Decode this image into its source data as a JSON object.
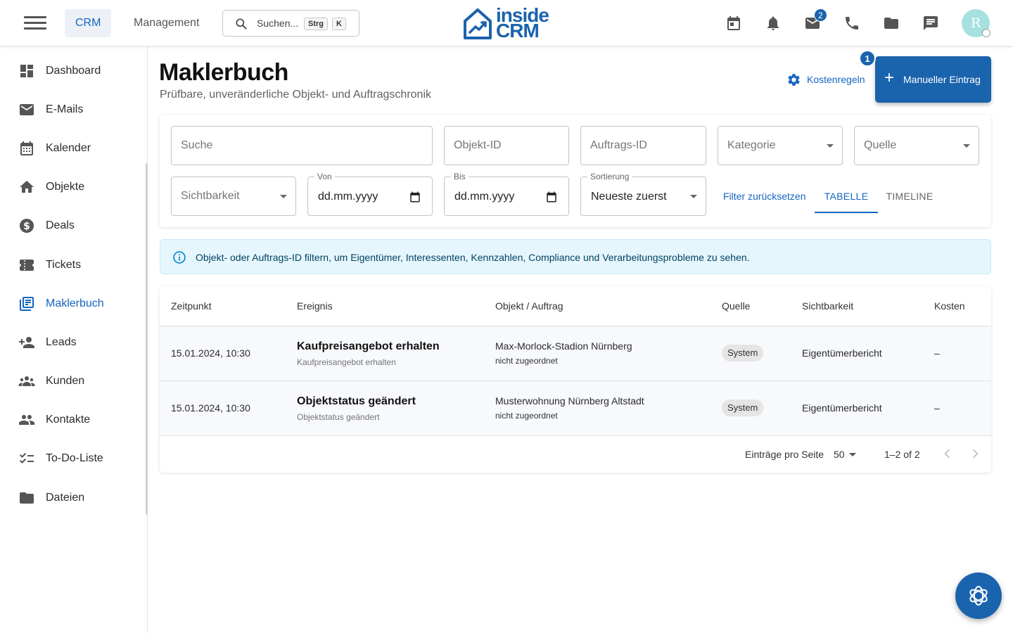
{
  "topbar": {
    "nav_tabs": [
      {
        "label": "CRM",
        "active": true
      },
      {
        "label": "Management",
        "active": false
      }
    ],
    "search": {
      "placeholder": "Suchen...",
      "shortcut_1": "Strg",
      "shortcut_2": "K"
    },
    "logo": {
      "line1": "inside",
      "line2": "CRM"
    },
    "icons": [
      "calendar-icon",
      "bell-icon",
      "mail-icon",
      "phone-icon",
      "folder-icon",
      "chat-icon"
    ],
    "mail_badge": "2",
    "avatar_initial": "R",
    "accent_color": "#1a63ad"
  },
  "sidebar": {
    "items": [
      {
        "label": "Dashboard",
        "icon": "dashboard-icon"
      },
      {
        "label": "E-Mails",
        "icon": "mail-icon"
      },
      {
        "label": "Kalender",
        "icon": "calendar-icon"
      },
      {
        "label": "Objekte",
        "icon": "home-icon"
      },
      {
        "label": "Deals",
        "icon": "dollar-icon"
      },
      {
        "label": "Tickets",
        "icon": "ticket-icon"
      },
      {
        "label": "Maklerbuch",
        "icon": "library-icon",
        "active": true
      },
      {
        "label": "Leads",
        "icon": "person-add-icon"
      },
      {
        "label": "Kunden",
        "icon": "groups-icon"
      },
      {
        "label": "Kontakte",
        "icon": "people-icon"
      },
      {
        "label": "To-Do-Liste",
        "icon": "checklist-icon"
      },
      {
        "label": "Dateien",
        "icon": "folder-icon"
      }
    ]
  },
  "header": {
    "title": "Maklerbuch",
    "subtitle": "Prüfbare, unveränderliche Objekt- und Auftragschronik",
    "cost_rules_label": "Kostenregeln",
    "manual_entry_label": "Manueller Eintrag",
    "manual_entry_badge": "1"
  },
  "filters": {
    "search_placeholder": "Suche",
    "object_id_placeholder": "Objekt-ID",
    "order_id_placeholder": "Auftrags-ID",
    "category_placeholder": "Kategorie",
    "source_placeholder": "Quelle",
    "visibility_placeholder": "Sichtbarkeit",
    "from_label": "Von",
    "from_value": "dd.mm.yyyy",
    "to_label": "Bis",
    "to_value": "dd.mm.yyyy",
    "sort_label": "Sortierung",
    "sort_value": "Neueste zuerst",
    "reset_label": "Filter zurücksetzen",
    "view_tabs": [
      {
        "label": "TABELLE",
        "active": true
      },
      {
        "label": "TIMELINE",
        "active": false
      }
    ]
  },
  "info": {
    "text": "Objekt- oder Auftrags-ID filtern, um Eigentümer, Interessenten, Kennzahlen, Compliance und Verarbeitungsprobleme zu sehen."
  },
  "table": {
    "columns": [
      "Zeitpunkt",
      "Ereignis",
      "Objekt / Auftrag",
      "Quelle",
      "Sichtbarkeit",
      "Kosten"
    ],
    "rows": [
      {
        "time": "15.01.2024, 10:30",
        "event_title": "Kaufpreisangebot erhalten",
        "event_sub": "Kaufpreisangebot erhalten",
        "object_title": "Max-Morlock-Stadion Nürnberg",
        "object_sub": "nicht zugeordnet",
        "source": "System",
        "visibility": "Eigentümerbericht",
        "cost": "–"
      },
      {
        "time": "15.01.2024, 10:30",
        "event_title": "Objektstatus geändert",
        "event_sub": "Objektstatus geändert",
        "object_title": "Musterwohnung Nürnberg Altstadt",
        "object_sub": "nicht zugeordnet",
        "source": "System",
        "visibility": "Eigentümerbericht",
        "cost": "–"
      }
    ],
    "pagination": {
      "rows_per_page_label": "Einträge pro Seite",
      "rows_per_page_value": "50",
      "range": "1–2 of 2"
    }
  }
}
